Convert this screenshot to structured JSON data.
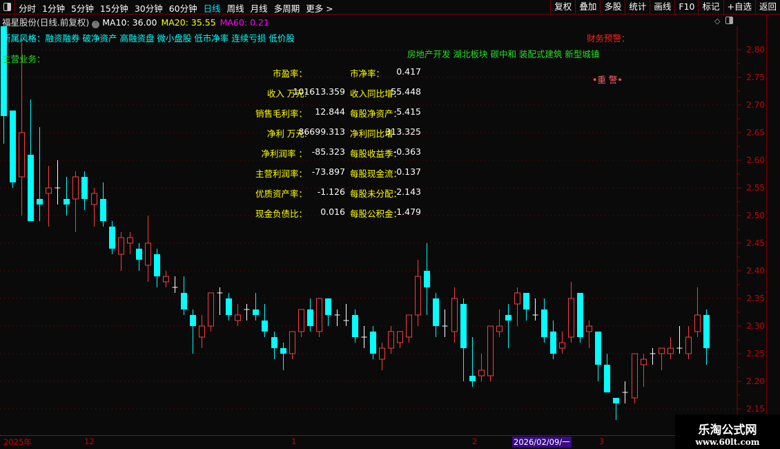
{
  "toolbar": {
    "periods": [
      "分时",
      "1分钟",
      "5分钟",
      "15分钟",
      "30分钟",
      "60分钟",
      "日线",
      "周线",
      "月线",
      "多周期",
      "更多 >"
    ],
    "active_period": "日线",
    "tools": [
      "复权",
      "叠加",
      "多股",
      "统计",
      "画线",
      "F10",
      "标记",
      "+自选",
      "返回"
    ]
  },
  "header": {
    "title": "福星股份(日线.前复权)",
    "ma10": "MA10: 36.00",
    "ma20": "MA20: 35.55",
    "ma60": "MA60: 0.21"
  },
  "overlay": {
    "style": "所属风格：融资融券 破净资产 高融资盘 微小盘股 低市净率 连续亏损 低价股",
    "business": "主营业务：",
    "concepts": "房地产开发 湖北板块 碳中和 装配式建筑 新型城镇",
    "warning": "财务预警：",
    "warning_badge": "•重 警•"
  },
  "financials": [
    {
      "l1": "市盈率：",
      "v1": "",
      "l2": "市净率：",
      "v2": "0.417"
    },
    {
      "l1": "收入 万元:",
      "v1": "101613.359",
      "l2": "收入同比增：",
      "v2": "55.448"
    },
    {
      "l1": "销售毛利率：",
      "v1": "12.844",
      "l2": "每股净资产：",
      "v2": "5.415"
    },
    {
      "l1": "净利 万元:",
      "v1": "86699.313",
      "l2": "净利同比增",
      "v2": "313.325"
    },
    {
      "l1": "净利润率 ：",
      "v1": "-85.323",
      "l2": "每股收益季：",
      "v2": "-0.363"
    },
    {
      "l1": "主营利润率：",
      "v1": "-73.897",
      "l2": "每股现金流：",
      "v2": "0.137"
    },
    {
      "l1": "优质资产率：",
      "v1": "-1.126",
      "l2": "每股未分配：",
      "v2": "2.143"
    },
    {
      "l1": "现金负债比：",
      "v1": "0.016",
      "l2": "每股公积金：",
      "v2": "1.479"
    }
  ],
  "date_axis": {
    "labels": [
      "2025年",
      "12",
      "1",
      "2",
      "3"
    ],
    "cursor_date": "2026/02/09/一"
  },
  "watermark": {
    "name": "乐淘公式网",
    "url": "www.60lt.com"
  },
  "colors": {
    "up": "#ff3c3c",
    "down": "#00ffff",
    "flat": "#ffffff",
    "grid": "#8a0000",
    "axis_text": "#cc0000"
  },
  "chart_data": {
    "type": "candlestick",
    "ylim": [
      2.1,
      2.85
    ],
    "y_ticks": [
      "2.80",
      "2.75",
      "2.70",
      "2.65",
      "2.60",
      "2.55",
      "2.50",
      "2.45",
      "2.40",
      "2.35",
      "2.30",
      "2.25",
      "2.20",
      "2.15"
    ],
    "ohlc": [
      [
        2.9,
        2.92,
        2.63,
        2.68
      ],
      [
        2.69,
        2.69,
        2.55,
        2.56
      ],
      [
        2.57,
        2.82,
        2.5,
        2.65
      ],
      [
        2.61,
        2.71,
        2.49,
        2.49
      ],
      [
        2.53,
        2.66,
        2.49,
        2.52
      ],
      [
        2.54,
        2.59,
        2.48,
        2.55
      ],
      [
        2.55,
        2.6,
        2.52,
        2.55
      ],
      [
        2.53,
        2.57,
        2.5,
        2.52
      ],
      [
        2.53,
        2.58,
        2.47,
        2.57
      ],
      [
        2.57,
        2.58,
        2.51,
        2.53
      ],
      [
        2.52,
        2.55,
        2.48,
        2.54
      ],
      [
        2.53,
        2.56,
        2.48,
        2.49
      ],
      [
        2.48,
        2.49,
        2.43,
        2.44
      ],
      [
        2.43,
        2.47,
        2.4,
        2.46
      ],
      [
        2.45,
        2.47,
        2.43,
        2.46
      ],
      [
        2.44,
        2.45,
        2.4,
        2.42
      ],
      [
        2.41,
        2.5,
        2.38,
        2.45
      ],
      [
        2.43,
        2.44,
        2.37,
        2.39
      ],
      [
        2.38,
        2.4,
        2.37,
        2.39
      ],
      [
        2.37,
        2.39,
        2.36,
        2.37
      ],
      [
        2.36,
        2.39,
        2.32,
        2.33
      ],
      [
        2.32,
        2.33,
        2.25,
        2.3
      ],
      [
        2.28,
        2.32,
        2.26,
        2.3
      ],
      [
        2.3,
        2.36,
        2.29,
        2.36
      ],
      [
        2.36,
        2.37,
        2.32,
        2.36
      ],
      [
        2.35,
        2.36,
        2.31,
        2.32
      ],
      [
        2.31,
        2.34,
        2.3,
        2.32
      ],
      [
        2.33,
        2.34,
        2.31,
        2.33
      ],
      [
        2.33,
        2.36,
        2.31,
        2.32
      ],
      [
        2.31,
        2.34,
        2.28,
        2.29
      ],
      [
        2.28,
        2.29,
        2.24,
        2.26
      ],
      [
        2.26,
        2.27,
        2.22,
        2.25
      ],
      [
        2.25,
        2.29,
        2.24,
        2.29
      ],
      [
        2.29,
        2.33,
        2.28,
        2.33
      ],
      [
        2.33,
        2.35,
        2.29,
        2.3
      ],
      [
        2.29,
        2.35,
        2.28,
        2.35
      ],
      [
        2.35,
        2.35,
        2.3,
        2.32
      ],
      [
        2.32,
        2.33,
        2.3,
        2.32
      ],
      [
        2.31,
        2.34,
        2.3,
        2.31
      ],
      [
        2.32,
        2.33,
        2.27,
        2.28
      ],
      [
        2.28,
        2.3,
        2.26,
        2.28
      ],
      [
        2.29,
        2.3,
        2.24,
        2.25
      ],
      [
        2.24,
        2.27,
        2.22,
        2.26
      ],
      [
        2.26,
        2.3,
        2.25,
        2.29
      ],
      [
        2.27,
        2.29,
        2.26,
        2.29
      ],
      [
        2.28,
        2.32,
        2.27,
        2.32
      ],
      [
        2.32,
        2.42,
        2.3,
        2.39
      ],
      [
        2.4,
        2.45,
        2.32,
        2.37
      ],
      [
        2.35,
        2.36,
        2.28,
        2.3
      ],
      [
        2.3,
        2.33,
        2.28,
        2.3
      ],
      [
        2.29,
        2.37,
        2.27,
        2.35
      ],
      [
        2.34,
        2.35,
        2.2,
        2.26
      ],
      [
        2.21,
        2.28,
        2.19,
        2.2
      ],
      [
        2.21,
        2.25,
        2.2,
        2.22
      ],
      [
        2.21,
        2.3,
        2.2,
        2.3
      ],
      [
        2.29,
        2.33,
        2.28,
        2.3
      ],
      [
        2.32,
        2.34,
        2.26,
        2.31
      ],
      [
        2.34,
        2.37,
        2.3,
        2.36
      ],
      [
        2.36,
        2.36,
        2.31,
        2.33
      ],
      [
        2.32,
        2.35,
        2.31,
        2.32
      ],
      [
        2.33,
        2.35,
        2.27,
        2.28
      ],
      [
        2.29,
        2.31,
        2.24,
        2.25
      ],
      [
        2.26,
        2.29,
        2.25,
        2.27
      ],
      [
        2.28,
        2.38,
        2.27,
        2.35
      ],
      [
        2.36,
        2.36,
        2.27,
        2.28
      ],
      [
        2.29,
        2.31,
        2.26,
        2.3
      ],
      [
        2.29,
        2.29,
        2.2,
        2.23
      ],
      [
        2.23,
        2.25,
        2.18,
        2.18
      ],
      [
        2.17,
        2.17,
        2.13,
        2.16
      ],
      [
        2.18,
        2.2,
        2.16,
        2.18
      ],
      [
        2.17,
        2.25,
        2.16,
        2.25
      ],
      [
        2.23,
        2.25,
        2.19,
        2.24
      ],
      [
        2.25,
        2.26,
        2.23,
        2.25
      ],
      [
        2.25,
        2.26,
        2.22,
        2.26
      ],
      [
        2.25,
        2.28,
        2.24,
        2.26
      ],
      [
        2.26,
        2.3,
        2.25,
        2.26
      ],
      [
        2.25,
        2.3,
        2.24,
        2.28
      ],
      [
        2.29,
        2.37,
        2.28,
        2.32
      ],
      [
        2.32,
        2.33,
        2.23,
        2.26
      ]
    ]
  }
}
